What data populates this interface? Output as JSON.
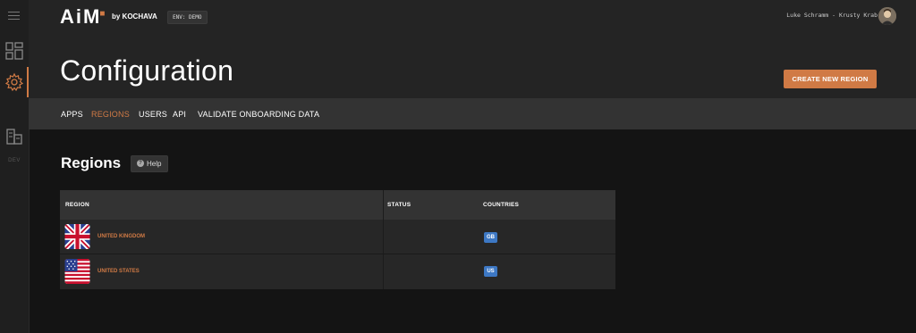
{
  "header": {
    "logo_text": "AiM",
    "byline": "by KOCHAVA",
    "env_label": "ENV: DEMO",
    "user_label": "Luke Schramm - Krusty Krab"
  },
  "sidebar": {
    "dev_label": "DEV",
    "icons": [
      "menu-icon",
      "dashboard-icon",
      "gear-icon",
      "buildings-icon"
    ]
  },
  "page": {
    "title": "Configuration",
    "create_button_label": "CREATE NEW REGION"
  },
  "tabs": [
    {
      "label": "APPS",
      "active": false
    },
    {
      "label": "REGIONS",
      "active": true
    },
    {
      "label": "USERS",
      "active": false
    },
    {
      "label": "API",
      "active": false
    },
    {
      "label": "VALIDATE ONBOARDING DATA",
      "active": false
    }
  ],
  "regions_section": {
    "title": "Regions",
    "help_label": "Help"
  },
  "table": {
    "headers": [
      "REGION",
      "STATUS",
      "COUNTRIES"
    ],
    "rows": [
      {
        "region": "UNITED KINGDOM",
        "status": "",
        "countries": [
          "GB"
        ],
        "flag": "uk-flag-icon"
      },
      {
        "region": "UNITED STATES",
        "status": "",
        "countries": [
          "US"
        ],
        "flag": "us-flag-icon"
      }
    ]
  },
  "colors": {
    "accent": "#d07a45",
    "badge": "#3d78c4",
    "background": "#141414",
    "header": "#242424"
  }
}
